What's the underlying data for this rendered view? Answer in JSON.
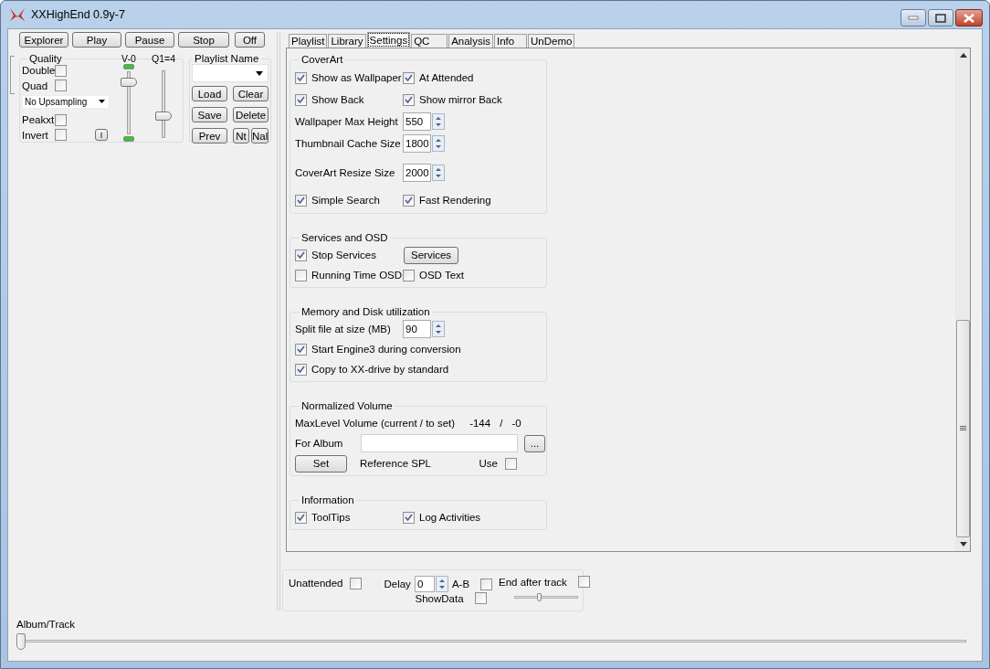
{
  "window": {
    "title": "XXHighEnd 0.9y-7"
  },
  "transport_buttons": [
    "Explorer",
    "Play",
    "Pause",
    "Stop",
    "Off"
  ],
  "quality": {
    "title": "Quality",
    "options": [
      {
        "label": "Double",
        "checked": false
      },
      {
        "label": "Quad",
        "checked": false
      }
    ],
    "upsampling": "No Upsampling",
    "options_2": [
      {
        "label": "Peakxt",
        "checked": false
      },
      {
        "label": "Invert",
        "checked": false
      }
    ],
    "i_button": "I",
    "volume": {
      "label": "V-0",
      "level": 0.85
    },
    "q": {
      "label": "Q1=4",
      "level": 0.3
    }
  },
  "playlist": {
    "title": "Playlist Name",
    "buttons": [
      "Load",
      "Clear",
      "Save",
      "Delete",
      "Prev"
    ],
    "small_buttons": [
      "Nt",
      "Nal"
    ]
  },
  "tabs": [
    {
      "label": "Playlist",
      "selected": false
    },
    {
      "label": "Library",
      "selected": false
    },
    {
      "label": "Settings",
      "selected": true
    },
    {
      "label": "QC",
      "selected": false
    },
    {
      "label": "Analysis",
      "selected": false
    },
    {
      "label": "Info",
      "selected": false
    },
    {
      "label": "UnDemo",
      "selected": false
    }
  ],
  "settings": {
    "groups": [
      {
        "title": "CoverArt",
        "rows": [
          [
            {
              "kind": "checkbox",
              "label": "Show as Wallpaper",
              "checked": true
            },
            {
              "kind": "checkbox",
              "label": "At Attended",
              "checked": true
            }
          ],
          [
            {
              "kind": "checkbox",
              "label": "Show Back",
              "checked": true
            },
            {
              "kind": "checkbox",
              "label": "Show mirror Back",
              "checked": true
            }
          ],
          [
            {
              "kind": "spinner",
              "label": "Wallpaper Max Height",
              "value": "550"
            }
          ],
          [
            {
              "kind": "spinner",
              "label": "Thumbnail Cache Size",
              "value": "1800"
            }
          ],
          [
            {
              "kind": "spinner",
              "label": "CoverArt Resize Size",
              "value": "2000"
            }
          ],
          [
            {
              "kind": "checkbox",
              "label": "Simple Search",
              "checked": true
            },
            {
              "kind": "checkbox",
              "label": "Fast Rendering",
              "checked": true
            }
          ]
        ]
      },
      {
        "title": "Services and OSD",
        "rows": [
          [
            {
              "kind": "checkbox",
              "label": "Stop Services",
              "checked": true
            },
            {
              "kind": "button",
              "label": "Services"
            }
          ],
          [
            {
              "kind": "checkbox",
              "label": "Running Time OSD",
              "checked": false
            },
            {
              "kind": "checkbox",
              "label": "OSD Text",
              "checked": false
            }
          ]
        ]
      },
      {
        "title": "Memory and Disk utilization",
        "rows": [
          [
            {
              "kind": "spinner",
              "label": "Split file at size (MB)",
              "value": "90"
            }
          ],
          [
            {
              "kind": "checkbox",
              "label": "Start Engine3 during conversion",
              "checked": true
            }
          ],
          [
            {
              "kind": "checkbox",
              "label": "Copy to XX-drive by standard",
              "checked": true
            }
          ]
        ]
      },
      {
        "title": "Normalized Volume",
        "rows": [
          [
            {
              "kind": "text",
              "label": "MaxLevel Volume (current / to set)"
            },
            {
              "kind": "reading",
              "label": "-144"
            },
            {
              "kind": "reading",
              "label": "/"
            },
            {
              "kind": "reading",
              "label": "-0"
            }
          ],
          [
            {
              "kind": "field",
              "label": "For Album"
            },
            {
              "kind": "button",
              "label": "..."
            }
          ],
          [
            {
              "kind": "button",
              "label": "Set"
            },
            {
              "kind": "text",
              "label": "Reference SPL"
            },
            {
              "kind": "trailing_checkbox",
              "label": "Use",
              "checked": false
            }
          ]
        ]
      },
      {
        "title": "Information",
        "rows": [
          [
            {
              "kind": "checkbox",
              "label": "ToolTips",
              "checked": true
            },
            {
              "kind": "checkbox",
              "label": "Log Activities",
              "checked": true
            }
          ]
        ]
      }
    ]
  },
  "playback_options": {
    "unattended": {
      "label": "Unattended",
      "checked": false
    },
    "delay": {
      "label": "Delay",
      "value": "0"
    },
    "ab": {
      "label": "A-B",
      "checked": false
    },
    "end_after_track": {
      "label": "End after track",
      "checked": false
    },
    "show_data": {
      "label": "ShowData",
      "checked": false
    },
    "slider": {
      "level": 0.4
    }
  },
  "album_track": {
    "label": "Album/Track",
    "level": 0
  }
}
